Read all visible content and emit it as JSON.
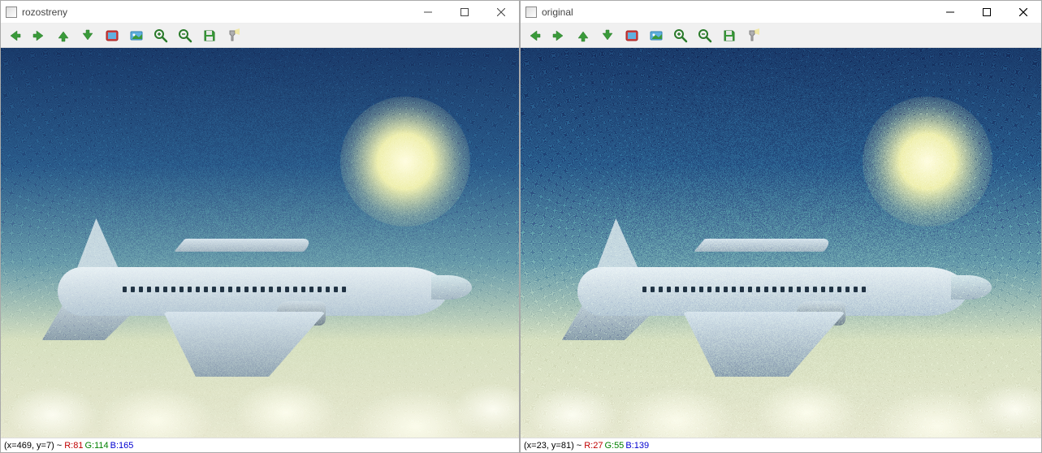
{
  "windows": [
    {
      "title": "rozostreny",
      "status": {
        "coord": "(x=469, y=7)",
        "tilde": "~",
        "r": "R:81",
        "g": "G:114",
        "b": "B:165"
      }
    },
    {
      "title": "original",
      "status": {
        "coord": "(x=23, y=81)",
        "tilde": "~",
        "r": "R:27",
        "g": "G:55",
        "b": "B:139"
      }
    }
  ],
  "toolbar_icons": [
    "nav-back-icon",
    "nav-forward-icon",
    "nav-up-icon",
    "nav-down-icon",
    "fit-image-icon",
    "original-size-icon",
    "zoom-in-icon",
    "zoom-out-icon",
    "save-icon",
    "cursor-tool-icon"
  ]
}
